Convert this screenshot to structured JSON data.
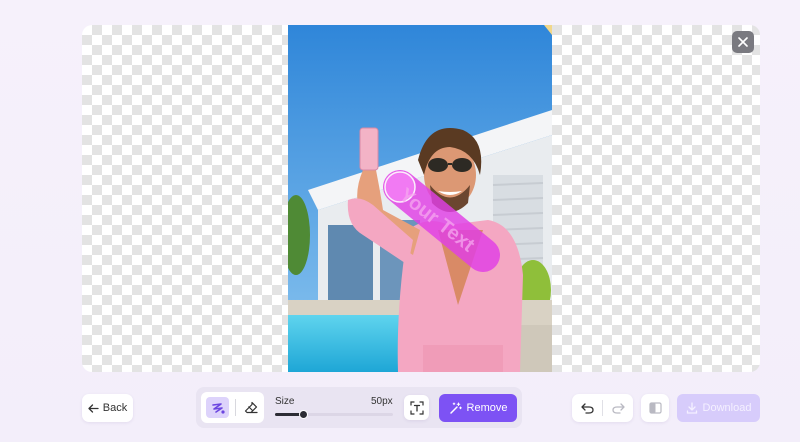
{
  "editor": {
    "close_icon": "close-icon",
    "watermark_text": "Your Text"
  },
  "footer": {
    "back_label": "Back",
    "size_label": "Size",
    "size_value": "50px",
    "brush_size_fraction": 0.24,
    "remove_label": "Remove",
    "download_label": "Download"
  },
  "colors": {
    "accent": "#7d52f4",
    "accent_disabled": "#d7ccfb",
    "brush_mask": "#e13fe6"
  }
}
